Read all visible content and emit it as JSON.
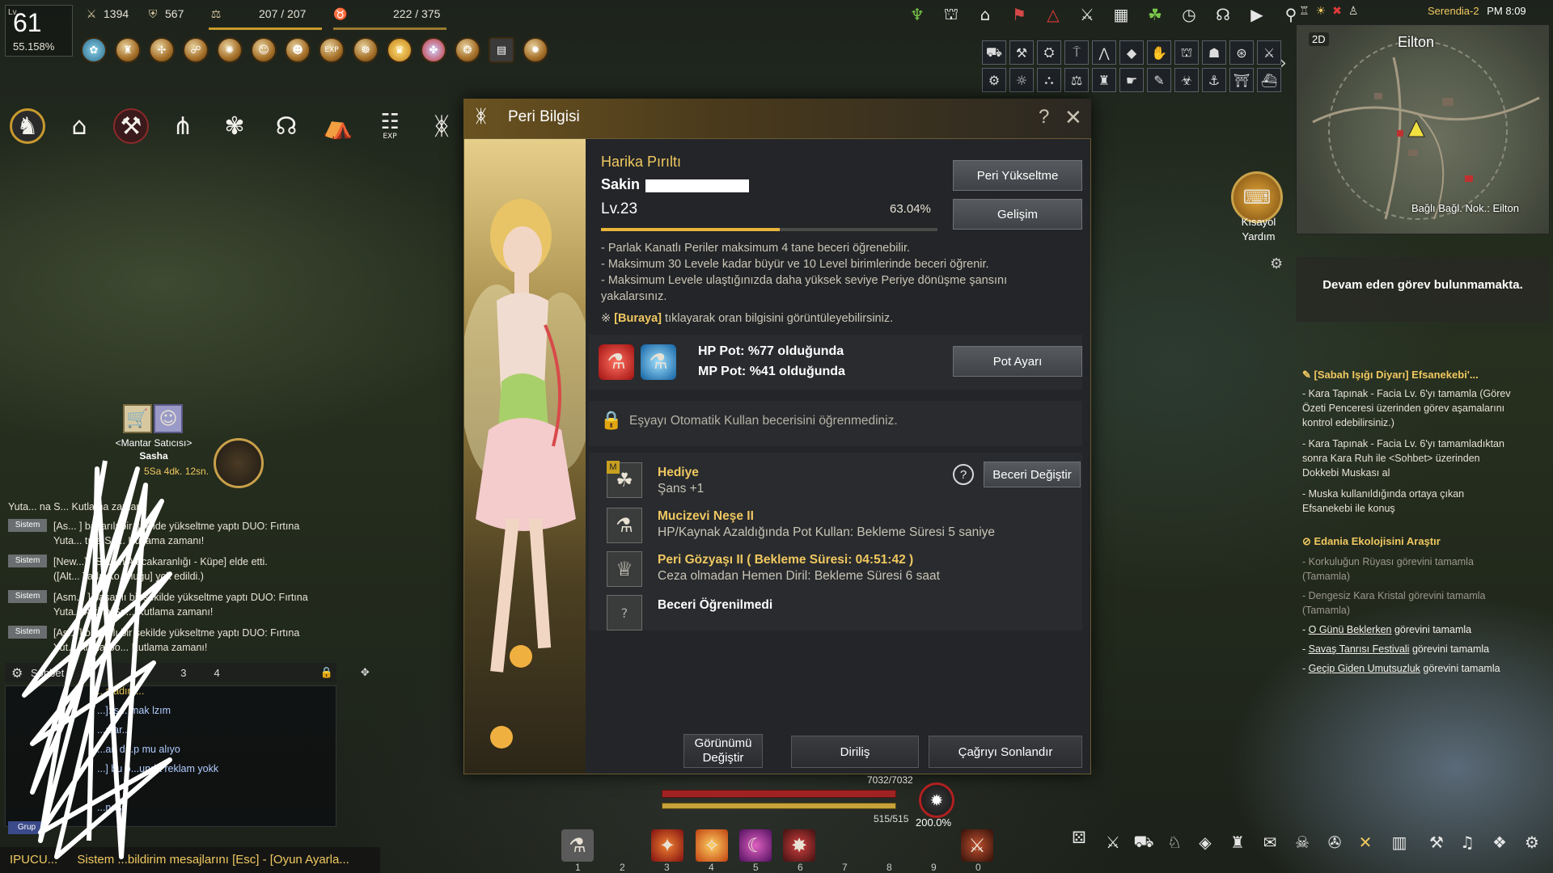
{
  "hud": {
    "level_label": "Lv.",
    "level": "61",
    "level_pct": "55.158%",
    "attack": "1394",
    "defense": "567",
    "weight": "207 / 207",
    "energy": "222 / 375",
    "menu_exp": "EXP"
  },
  "server": {
    "name": "Serendia-2",
    "time": "PM 8:09"
  },
  "minimap": {
    "mode": "2D",
    "region": "Eilton",
    "node": "Bağlı Bağl. Nok.: Eilton",
    "shortcut_label_1": "Kısayol",
    "shortcut_label_2": "Yardım"
  },
  "quests": {
    "none": "Devam eden görev bulunmamakta.",
    "group1_title": "[Sabah Işığı Diyarı] Efsanekebi'...",
    "group1_lines": [
      "- Kara Tapınak - Facia Lv. 6'yı tamamla (Görev",
      "Özeti Penceresi üzerinden görev aşamalarını",
      "kontrol edebilirsiniz.)",
      "- Kara Tapınak - Facia Lv. 6'yı tamamladıktan",
      "sonra Kara Ruh ile <Sohbet> üzerinden",
      "Dokkebi Muskası al",
      "- Muska kullanıldığında ortaya çıkan",
      "Efsanekebi ile konuş"
    ],
    "group2_title": "Edania Ekolojisini Araştır",
    "group2_dim": [
      "- Korkuluğun Rüyası görevini tamamla",
      "(Tamamla)",
      "- Dengesiz Kara Kristal görevini tamamla",
      "(Tamamla)"
    ],
    "group2_done": [
      {
        "link": "O Günü Beklerken",
        "rest": " görevini tamamla"
      },
      {
        "link": "Savaş Tanrısı Festivali",
        "rest": " görevini tamamla"
      },
      {
        "link": "Geçip Giden Umutsuzluk",
        "rest": " görevini tamamla"
      }
    ]
  },
  "chat": {
    "tag": "Sistem",
    "lines": [
      [
        "[As... ] başarılı bir şekilde yükseltme yaptı DUO: Fırtına",
        "Yuta... tına So... Kutlama zamanı!"
      ],
      [
        "[New...], [Sa... n Alacakaranlığı - Küpe] elde etti.",
        "([Alt... Tarla Ko... luğu] yok edildi.)"
      ],
      [
        "[Asm... ] başarılı bir şekilde yükseltme yaptı DUO: Fırtına",
        "Yuta... Artina So... Kutlama zamanı!"
      ],
      [
        "[As... ] başarılı bir şekilde yükseltme yaptı DUO: Fırtına",
        "Yut... Artina So... Kutlama zamanı!"
      ]
    ],
    "first_line": "Yuta... na S... Kutlama zamanı!",
    "tabs": [
      "Sohbet",
      "3",
      "4"
    ],
    "msgs": [
      "...aladım...",
      "...]: s... mak lzım",
      "...alar...",
      "...an d...p mu alıyo",
      "...] bu o...unda reklam yokk",
      "...nasıl"
    ],
    "grp": "Grup",
    "tip_label": "IPUCU...",
    "tip_text": "Sistem ...bildirim mesajlarını [Esc] - [Oyun Ayarla..."
  },
  "npc": {
    "name": "<Mantar Satıcısı>",
    "npc": "Sasha",
    "timer": "5Sa 4dk. 12sn."
  },
  "dialog": {
    "title": "Peri Bilgisi",
    "fairy_name": "Harika Pırıltı",
    "owner": "Sakin",
    "level": "Lv.23",
    "level_pct": "63.04%",
    "xp_fraction": 0.5304,
    "notes": [
      "- Parlak Kanatlı Periler maksimum 4 tane beceri öğrenebilir.",
      "- Maksimum 30 Levele kadar büyür ve 10 Level birimlerinde beceri öğrenir.",
      "- Maksimum Levele ulaştığınızda daha yüksek seviye Periye dönüşme şansını",
      "yakalarsınız."
    ],
    "note_link_prefix": "※ ",
    "note_link": "[Buraya]",
    "note_link_rest": " tıklayarak oran bilgisini görüntüleyebilirsiniz.",
    "btn_upgrade": "Peri Yükseltme",
    "btn_growth": "Gelişim",
    "hp_pot": "HP Pot: %77 olduğunda",
    "mp_pot": "MP Pot: %41 olduğunda",
    "btn_pot": "Pot Ayarı",
    "auto_use": "Eşyayı Otomatik Kullan becerisini öğrenmediniz.",
    "skills": [
      {
        "name": "Hediye",
        "desc": "Şans +1",
        "badge": "M"
      },
      {
        "name": "Mucizevi Neşe II",
        "desc": "HP/Kaynak Azaldığında Pot Kullan: Bekleme Süresi 5 saniye"
      },
      {
        "name": "Peri Gözyaşı II  ( Bekleme Süresi: 04:51:42 )",
        "desc": "Ceza olmadan Hemen Diril: Bekleme Süresi 6 saat"
      },
      {
        "name": "Beceri Öğrenilmedi",
        "desc": ""
      }
    ],
    "btn_change_skill": "Beceri Değiştir",
    "help": "?",
    "btn_look_1": "Görünümü",
    "btn_look_2": "Değiştir",
    "btn_revive": "Diriliş",
    "btn_end_call": "Çağrıyı Sonlandır"
  },
  "bottom": {
    "hp": "7032/7032",
    "mp": "515/515",
    "boss_pct": "200.0%",
    "slots": [
      "1",
      "2",
      "3",
      "4",
      "5",
      "6",
      "7",
      "8",
      "9",
      "0"
    ]
  },
  "colors": {
    "accent": "#f0c860",
    "dialog_bg": "#232528",
    "xp": "#e8b43a"
  }
}
